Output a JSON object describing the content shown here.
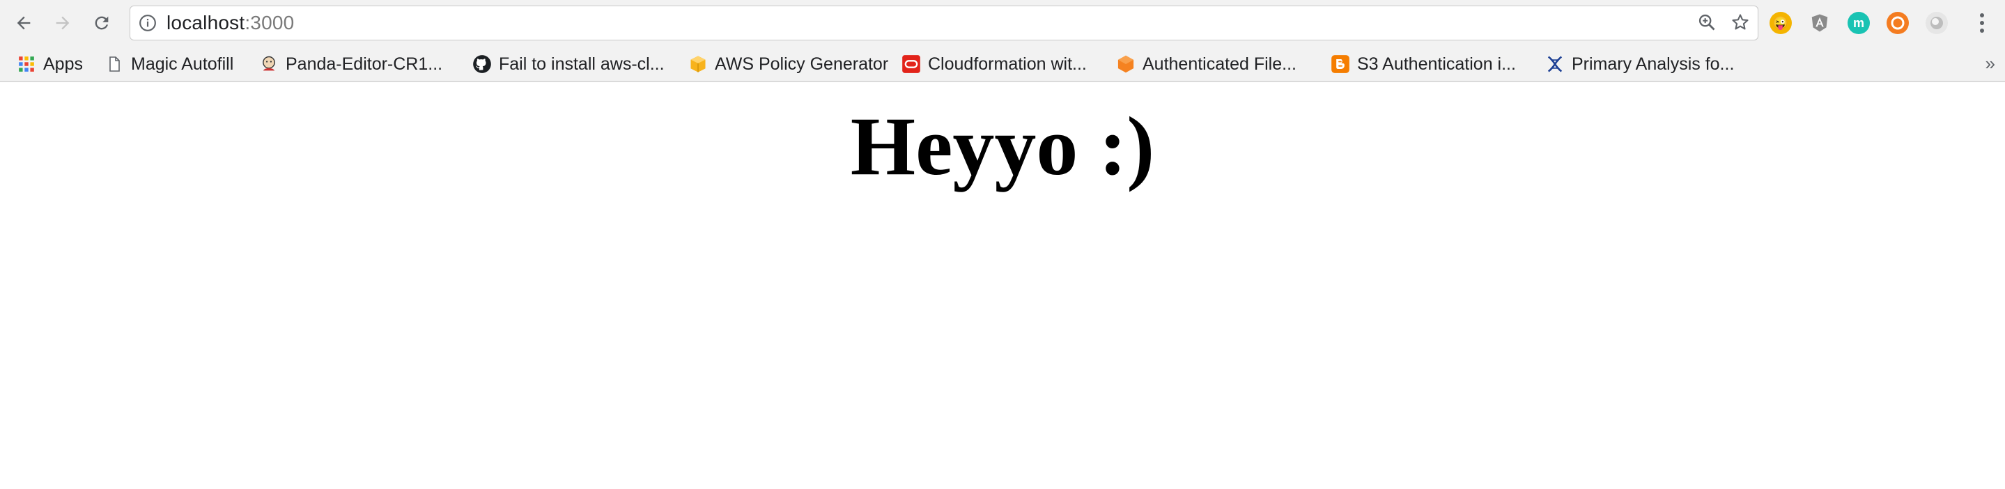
{
  "browser": {
    "url_host": "localhost",
    "url_port": ":3000",
    "icons": {
      "back": "back-arrow-icon",
      "forward": "forward-arrow-icon",
      "reload": "reload-icon",
      "info": "info-icon",
      "zoom": "zoom-icon",
      "star": "star-icon"
    },
    "extensions": [
      {
        "name": "emoji-extension-icon",
        "color": "#f4b400",
        "glyph": "😜"
      },
      {
        "name": "angular-extension-icon",
        "color": "#8a8a8a",
        "glyph": "A"
      },
      {
        "name": "m-extension-icon",
        "color": "#19c3b3",
        "glyph": "m"
      },
      {
        "name": "lifebuoy-extension-icon",
        "color": "#f47c20",
        "glyph": "◎"
      },
      {
        "name": "circle-extension-icon",
        "color": "#cfcfcf",
        "glyph": "●"
      }
    ]
  },
  "bookmarks": {
    "items": [
      {
        "label": "Apps",
        "icon": "apps-grid-icon"
      },
      {
        "label": "Magic Autofill",
        "icon": "page-icon"
      },
      {
        "label": "Panda-Editor-CR1...",
        "icon": "jenkins-icon"
      },
      {
        "label": "Fail to install aws-cl...",
        "icon": "github-icon"
      },
      {
        "label": "AWS Policy Generator",
        "icon": "aws-cube-icon"
      },
      {
        "label": "Cloudformation wit...",
        "icon": "oracle-icon"
      },
      {
        "label": "Authenticated File...",
        "icon": "hexagon-icon"
      },
      {
        "label": "S3 Authentication i...",
        "icon": "blogger-icon"
      },
      {
        "label": "Primary Analysis fo...",
        "icon": "dna-icon"
      }
    ],
    "more": "»"
  },
  "page": {
    "heading": "Heyyo :)"
  }
}
